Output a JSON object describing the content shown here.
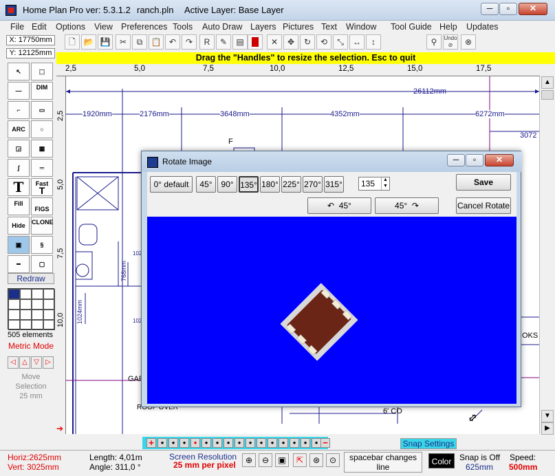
{
  "window": {
    "title": "Home Plan Pro ver: 5.3.1.2",
    "filename": "ranch.pln",
    "active_layer": "Active Layer: Base Layer"
  },
  "menu": [
    "File",
    "Edit",
    "Options",
    "View",
    "Preferences",
    "Tools",
    "Auto Draw",
    "Layers",
    "Pictures",
    "Text",
    "Window",
    "Tool Guide",
    "Help",
    "Updates"
  ],
  "coords": {
    "x": "X: 17750mm",
    "y": "Y: 12125mm"
  },
  "toolbar": {
    "undo_label": "Undo"
  },
  "hint": "Drag the \"Handles\" to resize the selection.  Esc to quit",
  "ruler": {
    "top": [
      "2,5",
      "5,0",
      "7,5",
      "10,0",
      "12,5",
      "15,0",
      "17,5"
    ],
    "left": [
      "2,5",
      "5,0",
      "7,5",
      "10,0"
    ]
  },
  "plan": {
    "overall_dim": "26112mm",
    "dims": [
      "1920mm",
      "2176mm",
      "3648mm",
      "4352mm",
      "6272mm",
      "3072"
    ],
    "labels": {
      "f": "F",
      "d1": "1024",
      "d2": "768mm",
      "d3": "1024mm",
      "d4": "1024",
      "gar": "GAR",
      "roof": "ROOF OVER",
      "closet": "6' CO",
      "oks": "OKS"
    }
  },
  "palette": {
    "dim": "DIM",
    "arc": "ARC",
    "fill": "Fill",
    "figs": "FIGS",
    "fast": "Fast",
    "hide": "Hide",
    "clone": "CLONE",
    "redraw": "Redraw",
    "elements": "505 elements",
    "mode": "Metric Mode",
    "move_selection": "Move Selection",
    "move_step": "25 mm"
  },
  "dialog": {
    "title": "Rotate Image",
    "angle_buttons": [
      "0°  default",
      "45°",
      "90°",
      "135°",
      "180°",
      "225°",
      "270°",
      "315°"
    ],
    "selected_angle": "135°",
    "angle_value": "135",
    "save": "Save",
    "cancel": "Cancel Rotate",
    "rotate_ccw": "45°",
    "rotate_cw": "45°",
    "preview_color": "#0000ff"
  },
  "status": {
    "horiz": "Horiz:2625mm",
    "vert": "Vert: 3025mm",
    "length": "Length: 4,01m",
    "angle": "Angle:  311,0 °",
    "screen_res": "Screen Resolution",
    "res_value": "25 mm per pixel",
    "spacebar_line1": "spacebar changes",
    "spacebar_line2": "line",
    "color": "Color",
    "snap": "Snap is Off",
    "snap_value": "625mm",
    "speed": "Speed:",
    "speed_value": "500mm",
    "snap_settings": "Snap Settings"
  }
}
